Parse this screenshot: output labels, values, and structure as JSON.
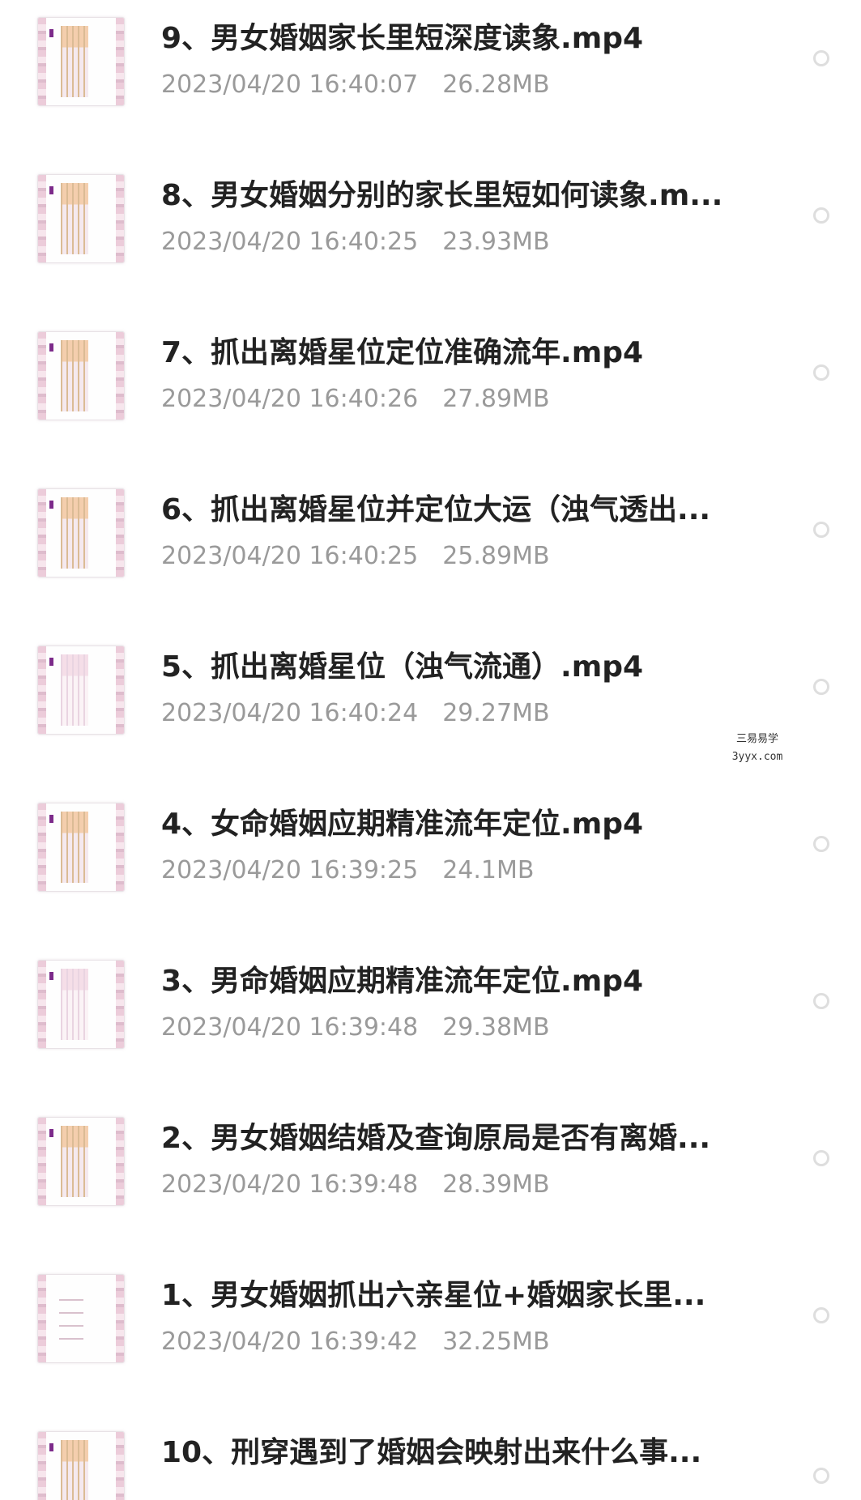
{
  "files": [
    {
      "title": "9、男女婚姻家长里短深度读象.mp4",
      "date": "2023/04/20 16:40:07",
      "size": "26.28MB",
      "thumb_style": "chart"
    },
    {
      "title": "8、男女婚姻分别的家长里短如何读象.m...",
      "date": "2023/04/20 16:40:25",
      "size": "23.93MB",
      "thumb_style": "chart"
    },
    {
      "title": "7、抓出离婚星位定位准确流年.mp4",
      "date": "2023/04/20 16:40:26",
      "size": "27.89MB",
      "thumb_style": "chart"
    },
    {
      "title": "6、抓出离婚星位并定位大运（浊气透出...",
      "date": "2023/04/20 16:40:25",
      "size": "25.89MB",
      "thumb_style": "chart"
    },
    {
      "title": "5、抓出离婚星位（浊气流通）.mp4",
      "date": "2023/04/20 16:40:24",
      "size": "29.27MB",
      "thumb_style": "chart"
    },
    {
      "title": "4、女命婚姻应期精准流年定位.mp4",
      "date": "2023/04/20 16:39:25",
      "size": "24.1MB",
      "thumb_style": "chart"
    },
    {
      "title": "3、男命婚姻应期精准流年定位.mp4",
      "date": "2023/04/20 16:39:48",
      "size": "29.38MB",
      "thumb_style": "chart"
    },
    {
      "title": "2、男女婚姻结婚及查询原局是否有离婚...",
      "date": "2023/04/20 16:39:48",
      "size": "28.39MB",
      "thumb_style": "chart"
    },
    {
      "title": "1、男女婚姻抓出六亲星位+婚姻家长里...",
      "date": "2023/04/20 16:39:42",
      "size": "32.25MB",
      "thumb_style": "lines"
    },
    {
      "title": "10、刑穿遇到了婚姻会映射出来什么事...",
      "date": "",
      "size": "",
      "thumb_style": "chart"
    }
  ],
  "watermark": {
    "line1": "三易易学",
    "line2": "3yyx.com"
  },
  "colors": {
    "title": "#222222",
    "meta": "#9a9a9a",
    "radio_border": "#dedede",
    "background": "#ffffff"
  },
  "icons": {
    "thumbnail": "video-thumbnail-icon",
    "select": "radio-unselected-icon"
  }
}
